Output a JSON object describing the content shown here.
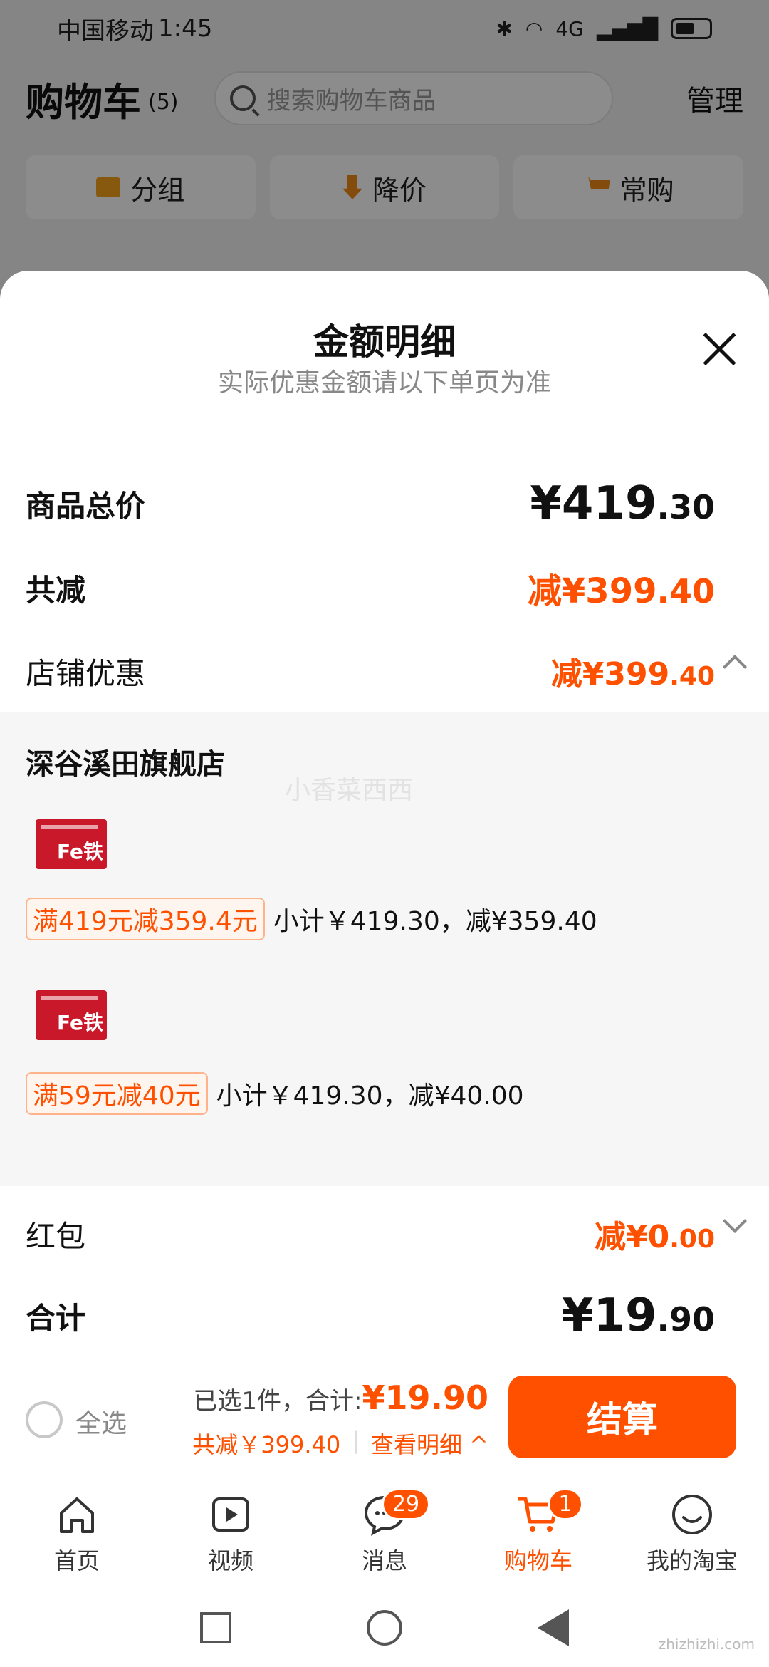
{
  "statusbar": {
    "carrier": "中国移动",
    "time": "1:45",
    "net": "4G"
  },
  "header": {
    "title": "购物车",
    "count": "(5)",
    "search_placeholder": "搜索购物车商品",
    "manage": "管理"
  },
  "chips": [
    {
      "label": "分组",
      "icon": "folder-icon"
    },
    {
      "label": "降价",
      "icon": "price-down-icon"
    },
    {
      "label": "常购",
      "icon": "cart-plus-icon"
    }
  ],
  "sheet": {
    "title": "金额明细",
    "subtitle": "实际优惠金额请以下单页为准",
    "total_label": "商品总价",
    "total_int": "¥419",
    "total_dec": ".30",
    "reduce_label": "共减",
    "reduce_int": "减¥399",
    "reduce_dec": ".40",
    "shop_discount_label": "店铺优惠",
    "shop_discount_int": "减¥399",
    "shop_discount_dec": ".40",
    "store_name": "深谷溪田旗舰店",
    "watermark": "小香菜西西",
    "product_label": "Fe铁",
    "promos": [
      {
        "tag": "满419元减359.4元",
        "text": "小计￥419.30，减¥359.40"
      },
      {
        "tag": "满59元减40元",
        "text": "小计￥419.30，减¥40.00"
      }
    ],
    "redpacket_label": "红包",
    "redpacket_int": "减¥0",
    "redpacket_dec": ".00",
    "sum_label": "合计",
    "sum_int": "¥19",
    "sum_dec": ".90"
  },
  "summary": {
    "select_all": "全选",
    "selected": "已选1件，合计:",
    "price": "¥19.90",
    "reduced": "共减￥399.40",
    "view_detail": "查看明细 ^",
    "checkout": "结算"
  },
  "nav": [
    {
      "label": "首页",
      "icon": "home-icon"
    },
    {
      "label": "视频",
      "icon": "video-icon"
    },
    {
      "label": "消息",
      "icon": "message-icon",
      "badge": "29"
    },
    {
      "label": "购物车",
      "icon": "cart-icon",
      "badge": "1",
      "active": true
    },
    {
      "label": "我的淘宝",
      "icon": "profile-icon"
    }
  ],
  "brand": "zhizhizhi.com",
  "colors": {
    "accent": "#ff5000"
  }
}
